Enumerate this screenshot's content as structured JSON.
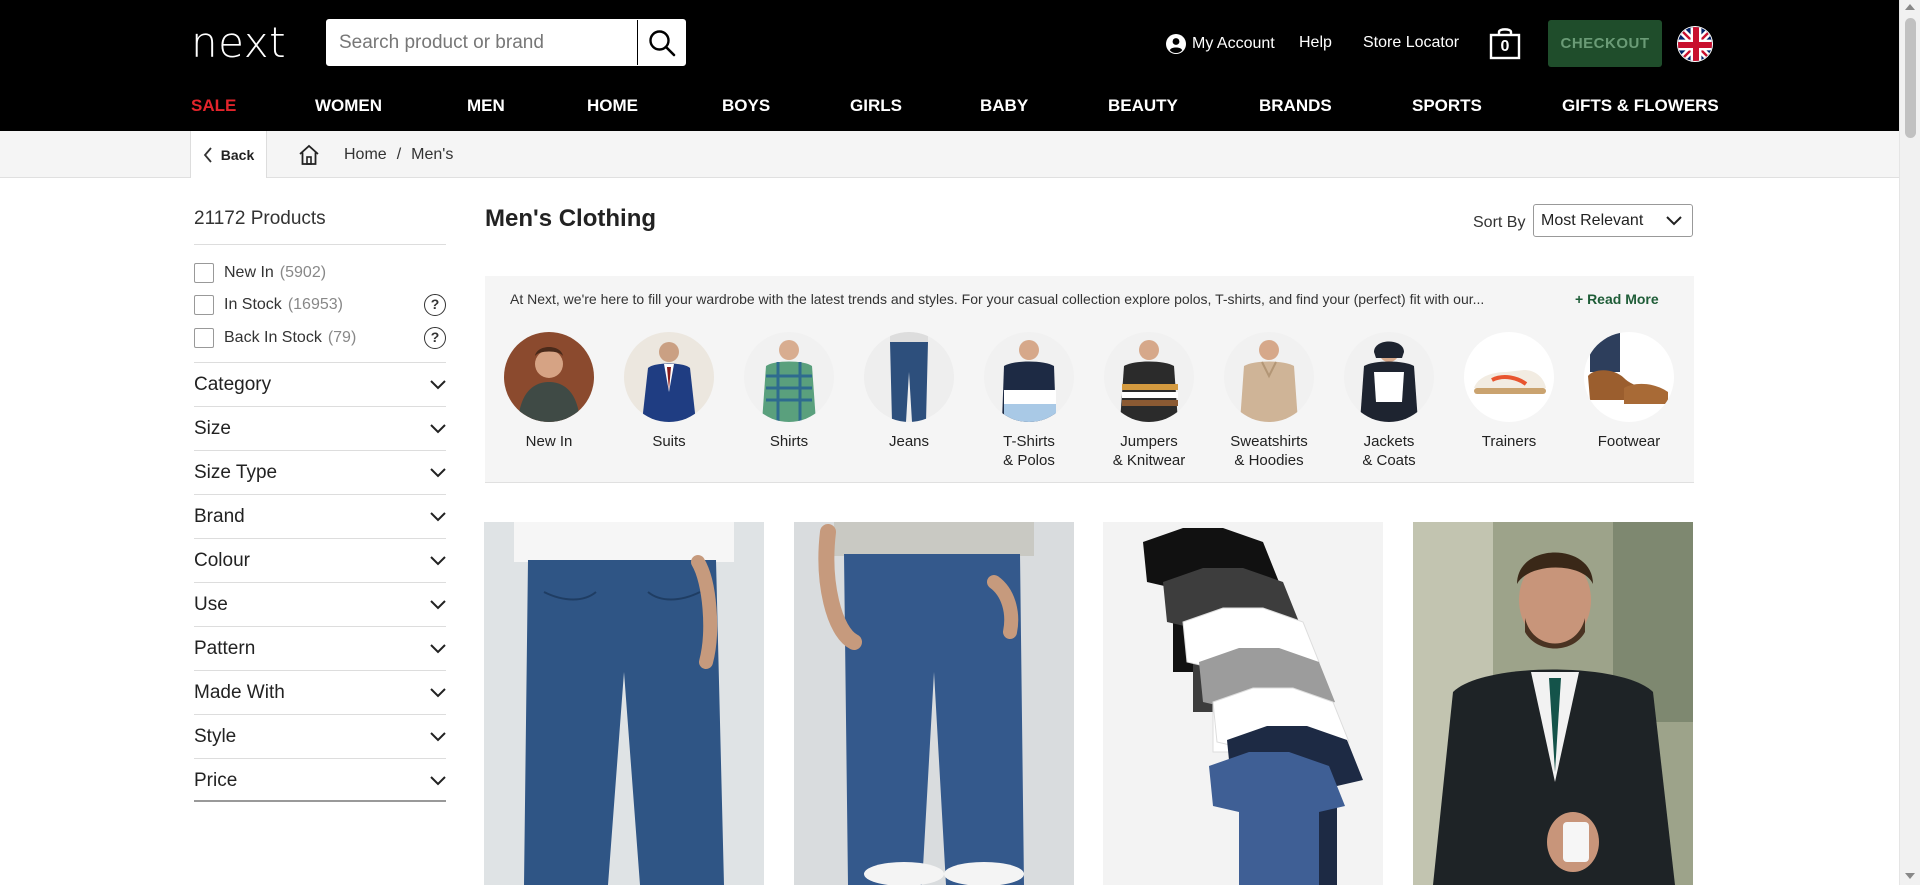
{
  "header": {
    "logo": "next",
    "search_placeholder": "Search product or brand",
    "my_account": "My Account",
    "help": "Help",
    "store_locator": "Store Locator",
    "bag_count": "0",
    "checkout": "CHECKOUT",
    "colors": {
      "background": "#000000",
      "checkout_bg": "#1f4d2b",
      "sale": "#e3242b"
    }
  },
  "nav": {
    "items": [
      {
        "label": "SALE"
      },
      {
        "label": "WOMEN"
      },
      {
        "label": "MEN"
      },
      {
        "label": "HOME"
      },
      {
        "label": "BOYS"
      },
      {
        "label": "GIRLS"
      },
      {
        "label": "BABY"
      },
      {
        "label": "BEAUTY"
      },
      {
        "label": "BRANDS"
      },
      {
        "label": "SPORTS"
      },
      {
        "label": "GIFTS & FLOWERS"
      }
    ]
  },
  "breadcrumb": {
    "back": "Back",
    "home": "Home",
    "separator": "/",
    "current": "Men's"
  },
  "sidebar": {
    "product_count": "21172 Products",
    "checks": [
      {
        "label": "New In",
        "count": "(5902)"
      },
      {
        "label": "In Stock",
        "count": "(16953)"
      },
      {
        "label": "Back In Stock",
        "count": "(79)"
      }
    ],
    "facets": [
      {
        "label": "Category"
      },
      {
        "label": "Size"
      },
      {
        "label": "Size Type"
      },
      {
        "label": "Brand"
      },
      {
        "label": "Colour"
      },
      {
        "label": "Use"
      },
      {
        "label": "Pattern"
      },
      {
        "label": "Made With"
      },
      {
        "label": "Style"
      },
      {
        "label": "Price"
      }
    ]
  },
  "main": {
    "title": "Men's Clothing",
    "sort_label": "Sort By",
    "sort_value": "Most Relevant",
    "promo_text": "At Next, we're here to fill your wardrobe with the latest trends and styles. For your casual collection explore polos, T-shirts, and find your (perfect) fit with our...",
    "read_more": "+ Read More",
    "categories": [
      {
        "line1": "New In",
        "line2": ""
      },
      {
        "line1": "Suits",
        "line2": ""
      },
      {
        "line1": "Shirts",
        "line2": ""
      },
      {
        "line1": "Jeans",
        "line2": ""
      },
      {
        "line1": "T-Shirts",
        "line2": "& Polos"
      },
      {
        "line1": "Jumpers",
        "line2": "& Knitwear"
      },
      {
        "line1": "Sweatshirts",
        "line2": "& Hoodies"
      },
      {
        "line1": "Jackets",
        "line2": "& Coats"
      },
      {
        "line1": "Trainers",
        "line2": ""
      },
      {
        "line1": "Footwear",
        "line2": ""
      }
    ]
  }
}
